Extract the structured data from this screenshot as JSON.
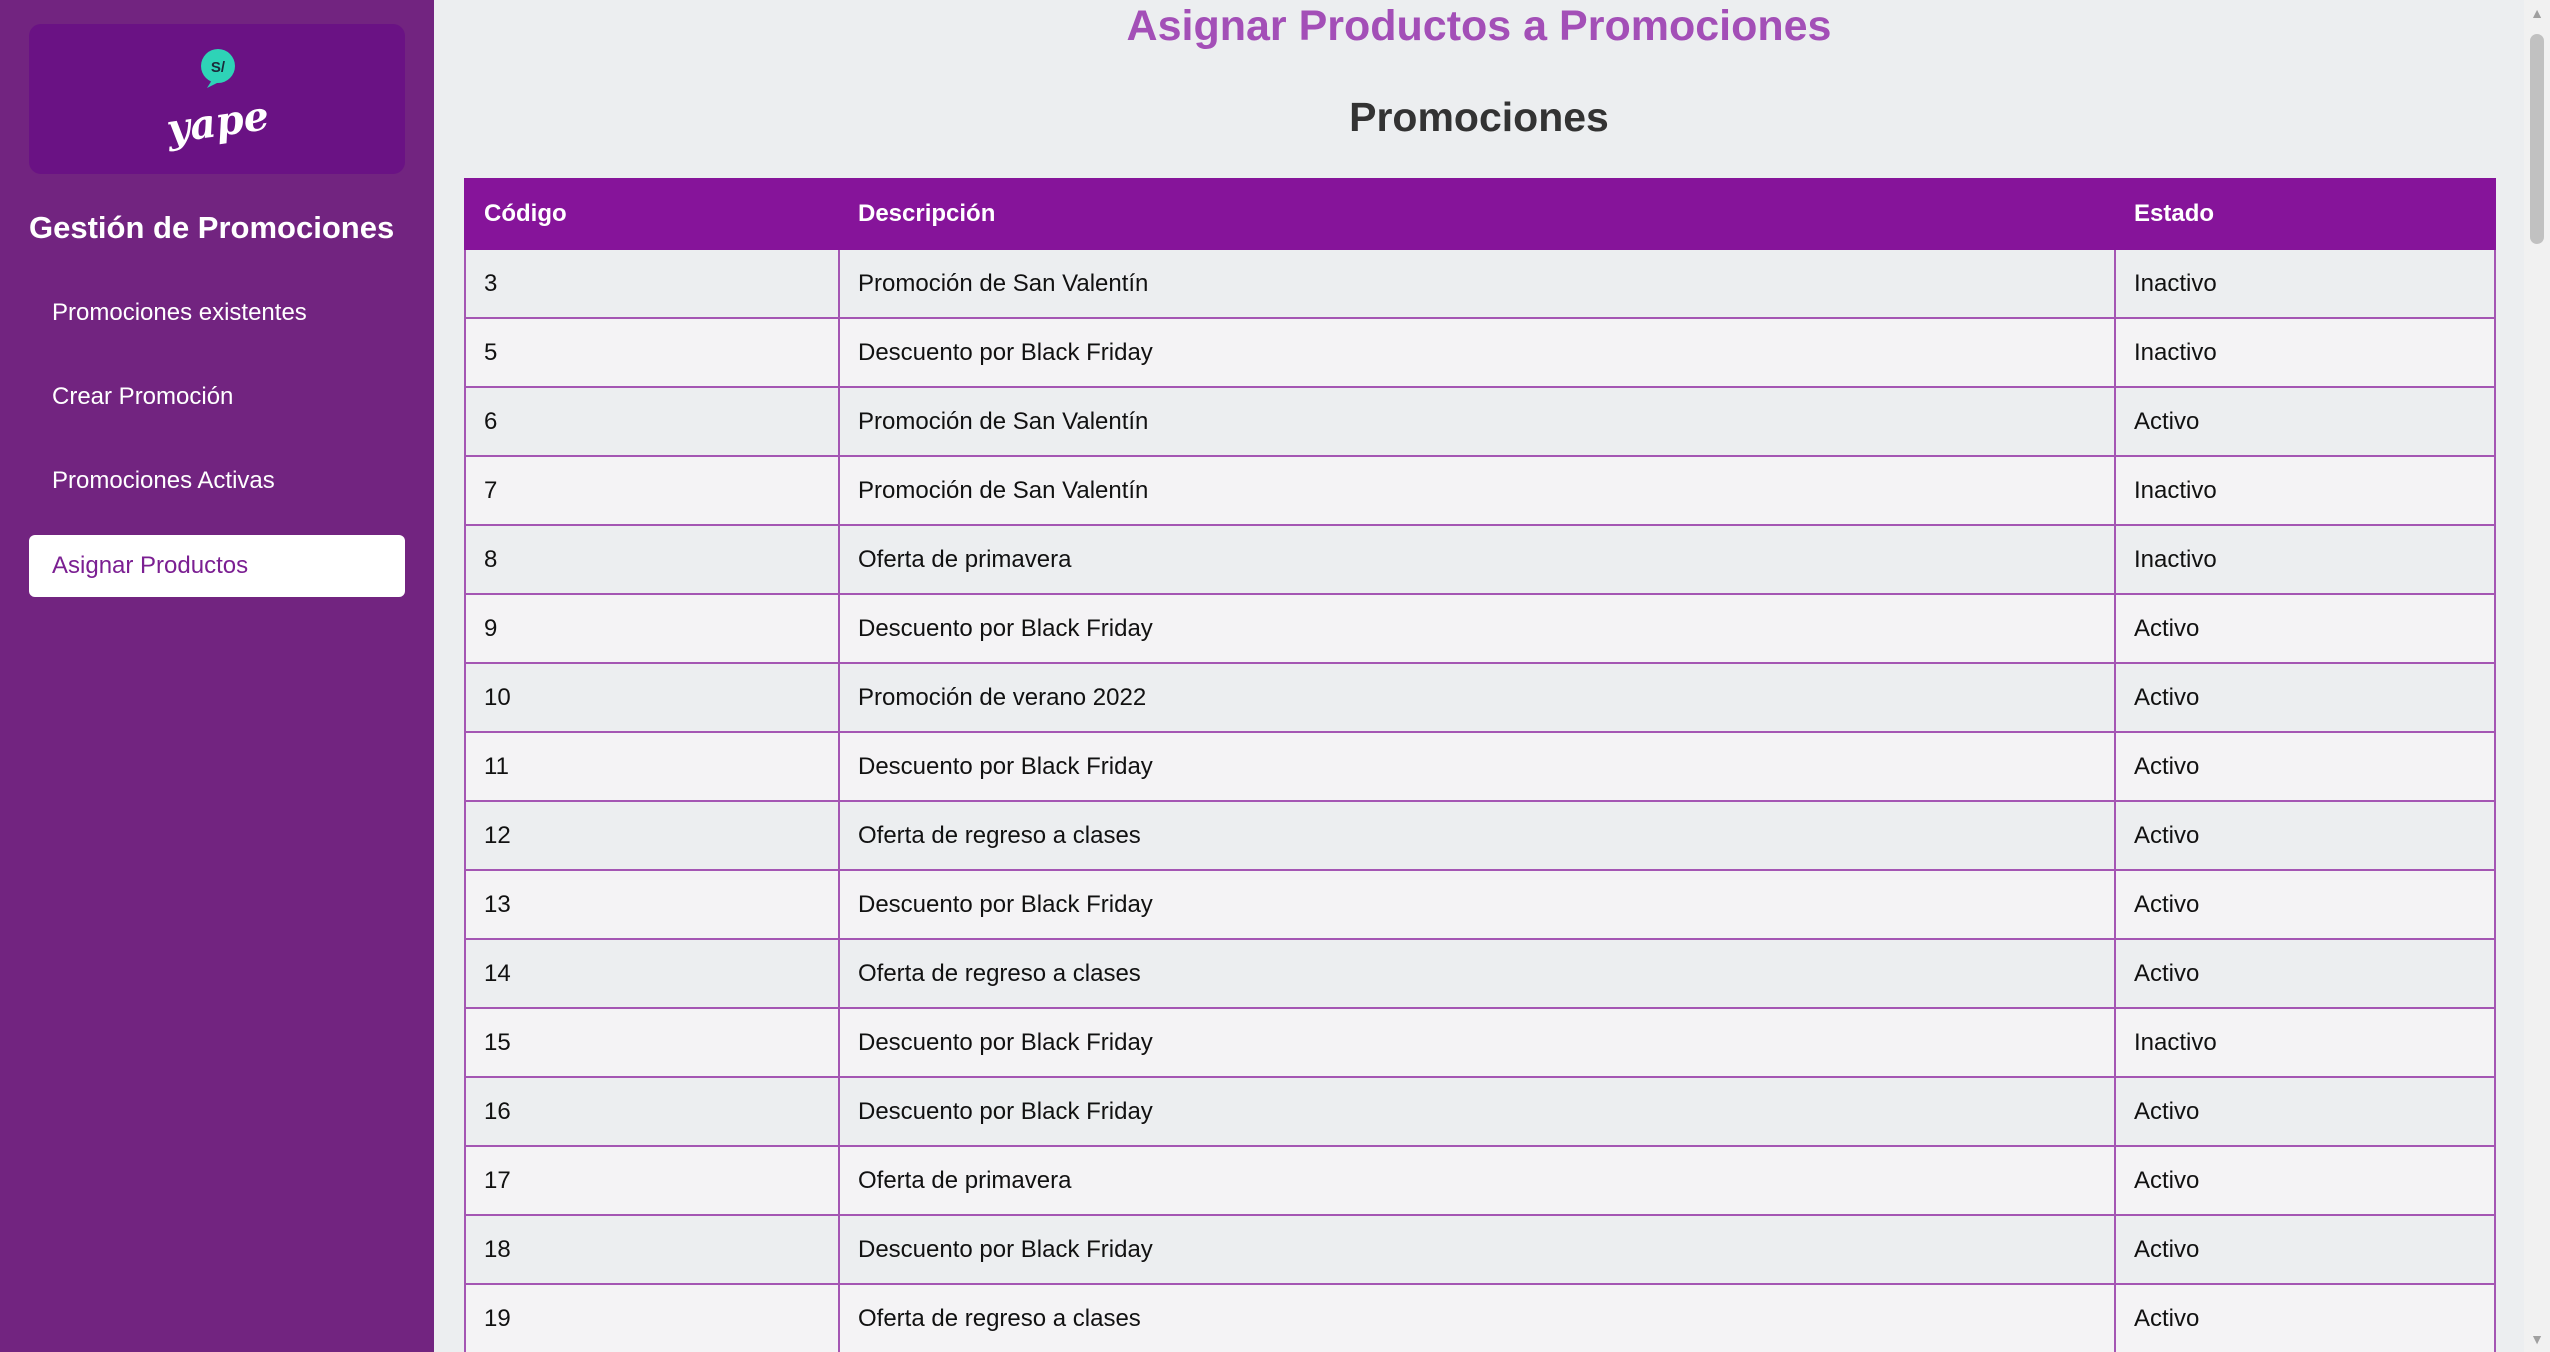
{
  "sidebar": {
    "logo_text": "yape",
    "logo_badge": "S/",
    "title": "Gestión de Promociones",
    "items": [
      {
        "label": "Promociones existentes"
      },
      {
        "label": "Crear Promoción"
      },
      {
        "label": "Promociones Activas"
      },
      {
        "label": "Asignar Productos"
      }
    ],
    "active_item": "Asignar Productos"
  },
  "main": {
    "page_title": "Asignar Productos a Promociones",
    "section_title": "Promociones",
    "table": {
      "headers": [
        "Código",
        "Descripción",
        "Estado"
      ],
      "rows": [
        [
          "3",
          "Promoción de San Valentín",
          "Inactivo"
        ],
        [
          "5",
          "Descuento por Black Friday",
          "Inactivo"
        ],
        [
          "6",
          "Promoción de San Valentín",
          "Activo"
        ],
        [
          "7",
          "Promoción de San Valentín",
          "Inactivo"
        ],
        [
          "8",
          "Oferta de primavera",
          "Inactivo"
        ],
        [
          "9",
          "Descuento por Black Friday",
          "Activo"
        ],
        [
          "10",
          "Promoción de verano 2022",
          "Activo"
        ],
        [
          "11",
          "Descuento por Black Friday",
          "Activo"
        ],
        [
          "12",
          "Oferta de regreso a clases",
          "Activo"
        ],
        [
          "13",
          "Descuento por Black Friday",
          "Activo"
        ],
        [
          "14",
          "Oferta de regreso a clases",
          "Activo"
        ],
        [
          "15",
          "Descuento por Black Friday",
          "Inactivo"
        ],
        [
          "16",
          "Descuento por Black Friday",
          "Activo"
        ],
        [
          "17",
          "Oferta de primavera",
          "Activo"
        ],
        [
          "18",
          "Descuento por Black Friday",
          "Activo"
        ],
        [
          "19",
          "Oferta de regreso a clases",
          "Activo"
        ]
      ]
    }
  },
  "colors": {
    "sidebar_bg": "#722480",
    "logo_bg": "#6a1284",
    "table_header_bg": "#86149a",
    "page_title_color": "#a34fb7",
    "active_nav_text": "#7b1f92",
    "logo_badge_color": "#2ed3b7"
  },
  "icons": [
    "yape-logo-icon",
    "scroll-up-arrow-icon",
    "scroll-down-arrow-icon"
  ]
}
